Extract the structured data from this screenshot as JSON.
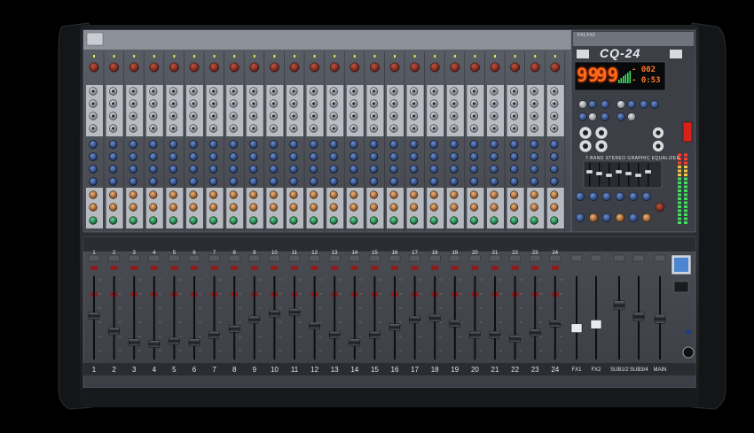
{
  "mixer": {
    "model": "CQ-24",
    "model_small": "FX1  FX2",
    "display_left": "99",
    "display_right": "99",
    "display_small_top": "- 002",
    "display_small_bottom": "- 0:53",
    "eq_title": "7-BAND STEREO GRAPHIC EQUALIZER"
  },
  "channels": {
    "count": 24,
    "labels": [
      "1",
      "2",
      "3",
      "4",
      "5",
      "6",
      "7",
      "8",
      "9",
      "10",
      "11",
      "12",
      "13",
      "14",
      "15",
      "16",
      "17",
      "18",
      "19",
      "20",
      "21",
      "22",
      "23",
      "24"
    ],
    "fader_levels": [
      0.55,
      0.35,
      0.2,
      0.18,
      0.22,
      0.2,
      0.3,
      0.38,
      0.5,
      0.58,
      0.6,
      0.42,
      0.3,
      0.2,
      0.3,
      0.4,
      0.5,
      0.52,
      0.45,
      0.3,
      0.3,
      0.25,
      0.33,
      0.45
    ]
  },
  "master": {
    "labels": [
      "FX1",
      "FX2",
      "SUB1/2",
      "SUB3/4",
      "MAIN"
    ],
    "fader_levels": [
      0.4,
      0.45,
      0.7,
      0.55,
      0.52
    ]
  },
  "colors": {
    "body": "#2a2c31",
    "panel": "#3a3d44",
    "knob_red": "#7a2018",
    "knob_blue": "#1f3f7e",
    "knob_orange": "#b16a2e",
    "knob_green": "#1f8a4a",
    "display_orange": "#ff6a1c",
    "meter_green": "#41e05f",
    "meter_red": "#ff3b30"
  }
}
